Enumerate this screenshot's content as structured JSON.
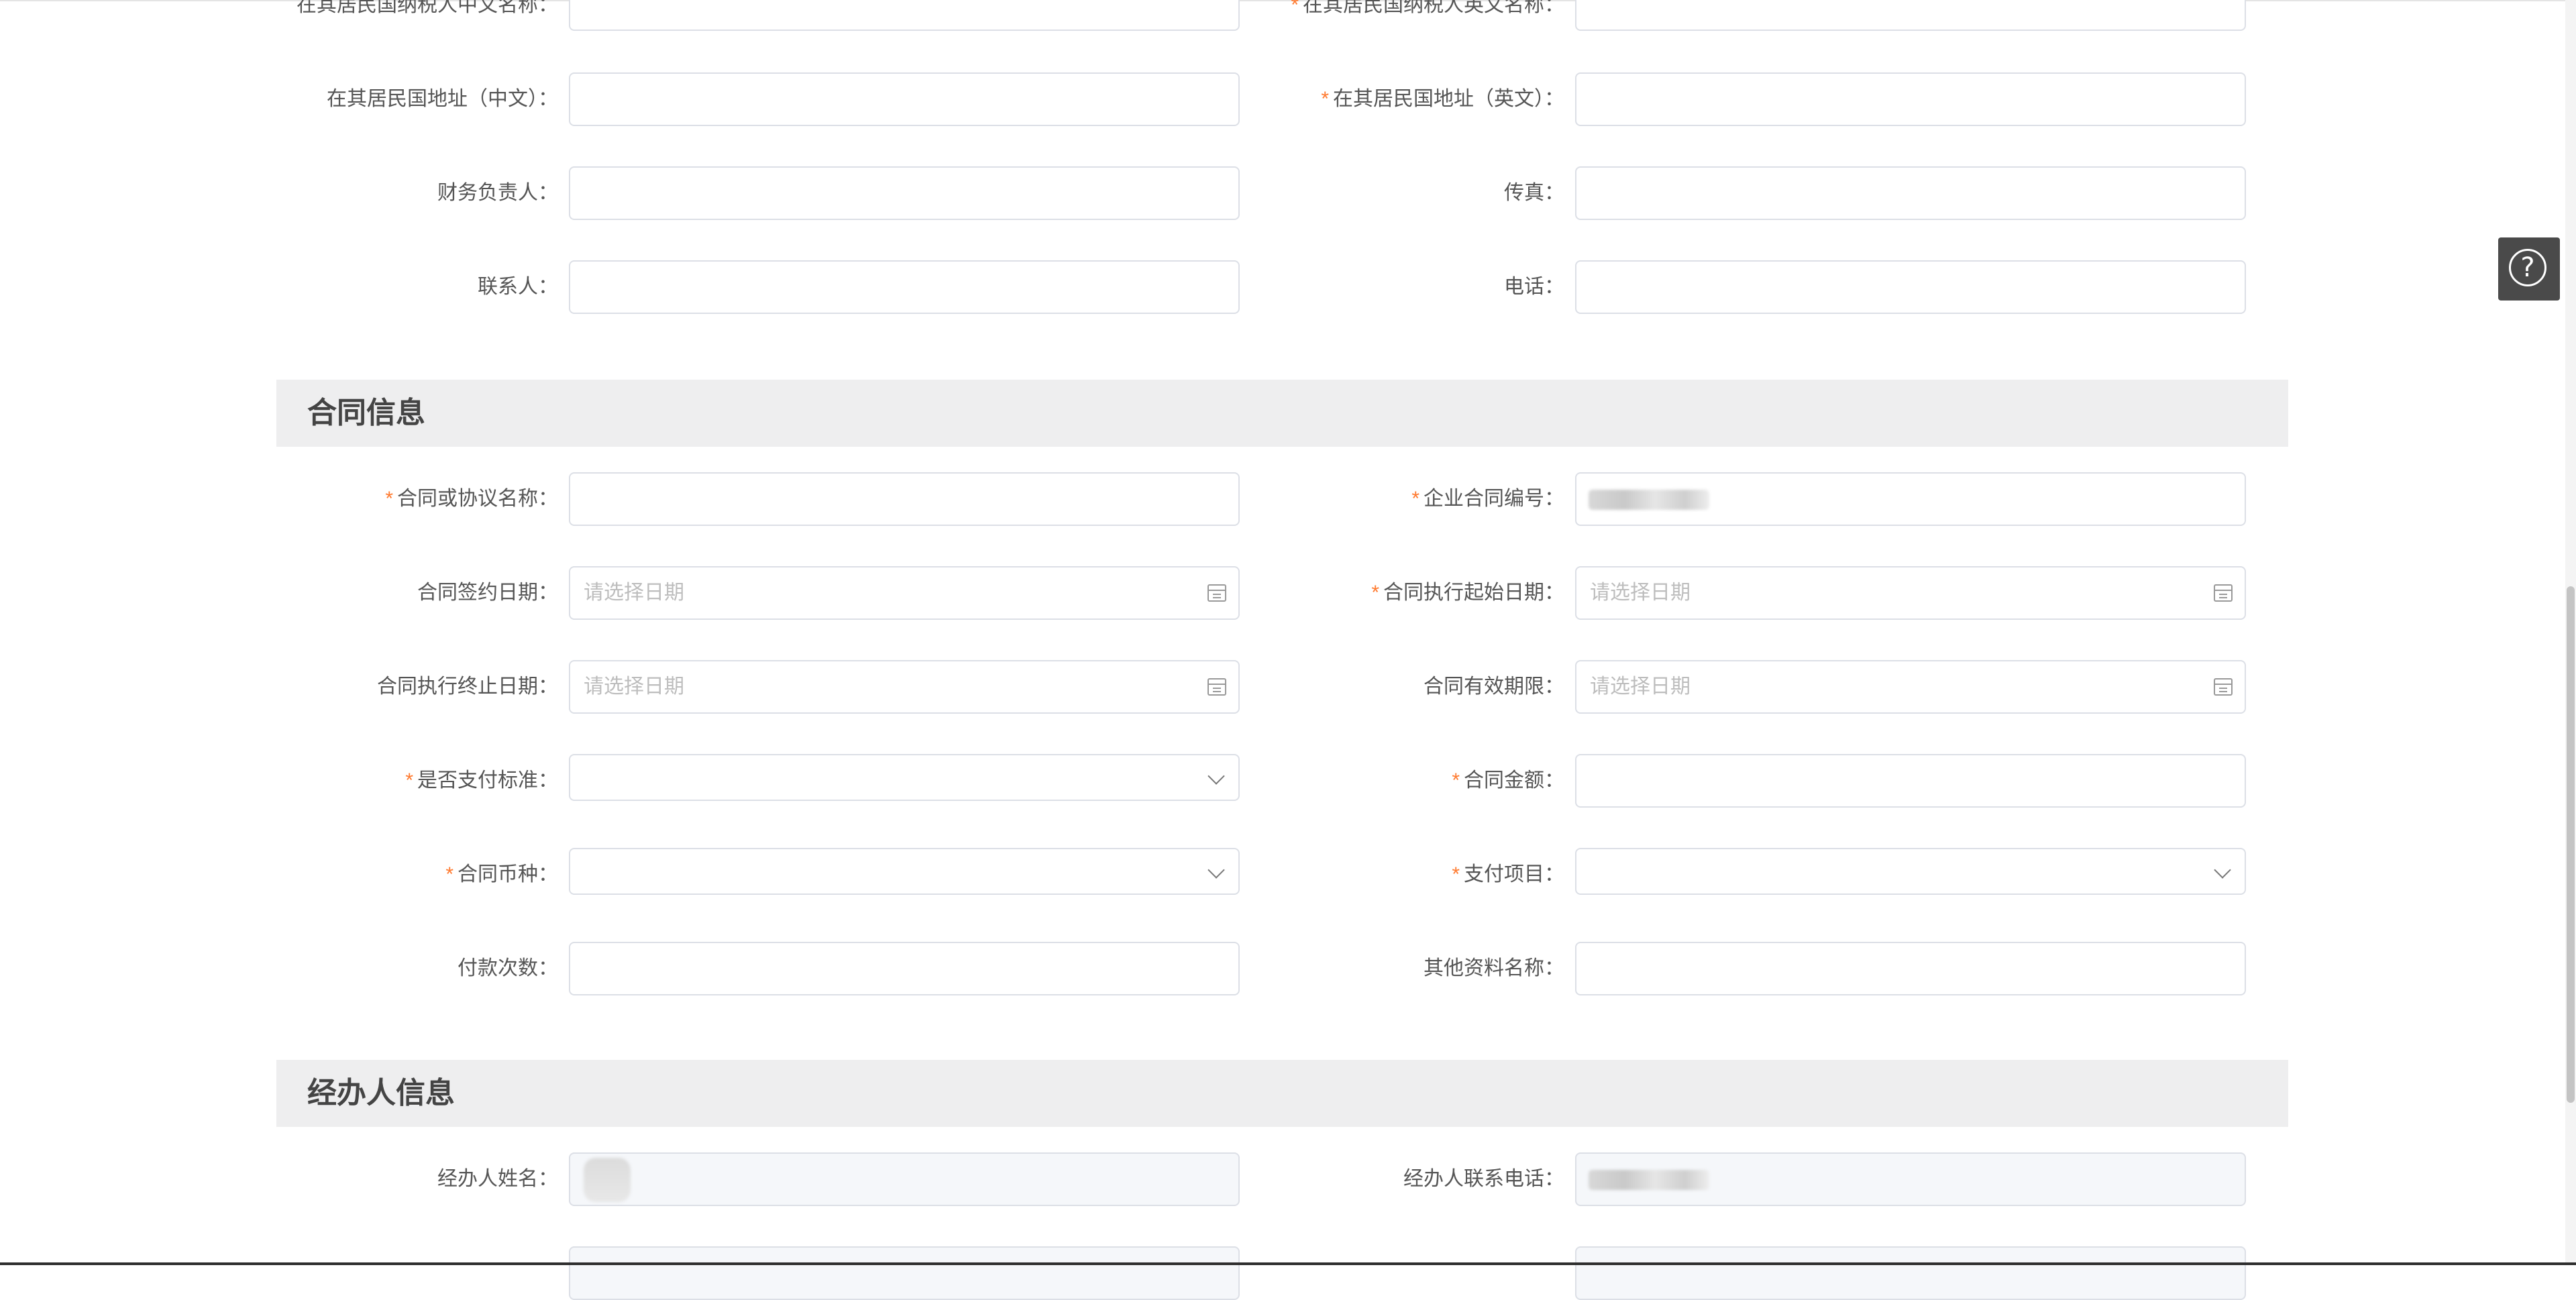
{
  "residence_info": {
    "cn_name_label": "在其居民国纳税人中文名称：",
    "en_name_label": "在其居民国纳税人英文名称：",
    "addr_cn_label": "在其居民国地址（中文）：",
    "addr_en_label": "在其居民国地址（英文）：",
    "finance_label": "财务负责人：",
    "fax_label": "传真：",
    "contact_label": "联系人：",
    "phone_label": "电话："
  },
  "contract_section": {
    "title": "合同信息",
    "name_label": "合同或协议名称：",
    "code_label": "企业合同编号：",
    "sign_date_label": "合同签约日期：",
    "exec_start_label": "合同执行起始日期：",
    "exec_end_label": "合同执行终止日期：",
    "valid_label": "合同有效期限：",
    "pay_standard_label": "是否支付标准：",
    "amount_label": "合同金额：",
    "currency_label": "合同币种：",
    "pay_item_label": "支付项目：",
    "pay_times_label": "付款次数：",
    "other_docs_label": "其他资料名称：",
    "date_placeholder": "请选择日期"
  },
  "agent_section": {
    "title": "经办人信息",
    "name_label": "经办人姓名：",
    "phone_label": "经办人联系电话："
  },
  "required_mark": "*",
  "help_icon_glyph": "?",
  "colors": {
    "required": "#ff7a2f",
    "section_bg": "#eeeeef",
    "border": "#dcdfe6"
  }
}
